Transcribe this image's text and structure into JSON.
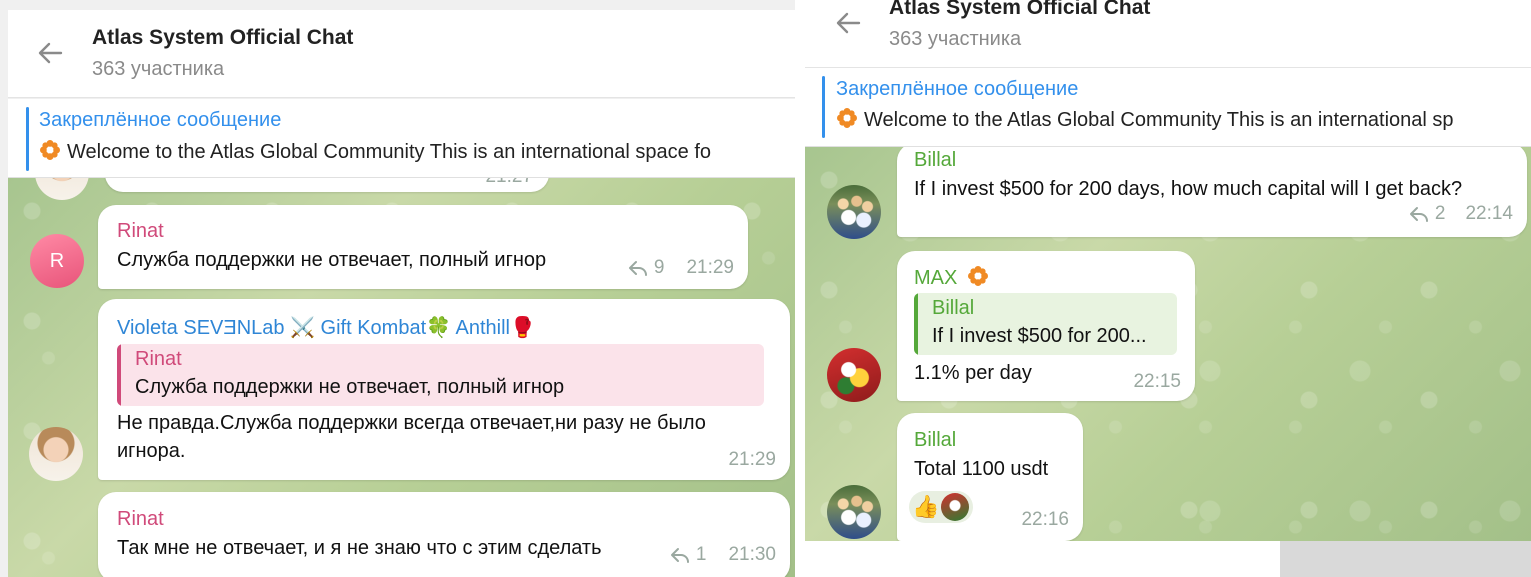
{
  "left": {
    "header": {
      "title": "Atlas System Official Chat",
      "subtitle": "363 участника"
    },
    "pinned": {
      "label": "Закреплённое сообщение",
      "text": "Welcome to the Atlas Global Community  This is an international space fo"
    },
    "partial_time": "21:27",
    "messages": [
      {
        "sender": "Rinat",
        "avatar_letter": "R",
        "text": "Служба поддержки не отвечает, полный игнор",
        "replies": "9",
        "time": "21:29"
      },
      {
        "sender": "Violeta SEVƎNLab ⚔️ Gift Kombat🍀 Anthill🥊",
        "quote": {
          "name": "Rinat",
          "text": "Служба поддержки не отвечает, полный игнор"
        },
        "text_line1": "Не правда.Служба поддержки всегда отвечает,ни разу не было",
        "text_line2": "игнора.",
        "time": "21:29"
      },
      {
        "sender": "Rinat",
        "text": "Так мне не отвечает, и я не знаю что с этим сделать",
        "replies": "1",
        "time": "21:30"
      }
    ]
  },
  "right": {
    "header": {
      "title": "Atlas System Official Chat",
      "subtitle": "363 участника"
    },
    "pinned": {
      "label": "Закреплённое сообщение",
      "text": "Welcome to the Atlas Global Community  This is an international sp"
    },
    "messages": [
      {
        "sender": "Billal",
        "text": "If I invest $500 for 200 days, how much capital will I get back?",
        "replies": "2",
        "time": "22:14"
      },
      {
        "sender": "MAX",
        "quote": {
          "name": "Billal",
          "text": "If I invest $500 for 200..."
        },
        "text": "1.1% per day",
        "time": "22:15"
      },
      {
        "sender": "Billal",
        "text": "Total 1100 usdt",
        "reaction": "👍",
        "time": "22:16"
      }
    ]
  },
  "colors": {
    "accent": "#3390ec",
    "rinat": "#d04a7a",
    "violeta": "#2f86d6",
    "billal": "#55a83a",
    "max": "#55a83a",
    "quote_pink": "#fbe3ea",
    "quote_green": "#e8f3e0"
  },
  "icons": [
    "back-arrow-icon",
    "flower-icon",
    "reply-icon",
    "thumbs-up-icon"
  ]
}
